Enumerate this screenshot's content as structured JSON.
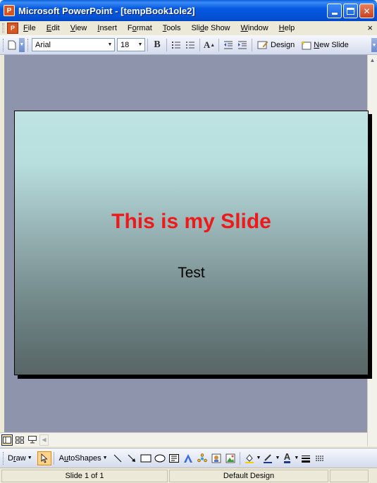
{
  "window": {
    "app_icon": "powerpoint-icon",
    "title": "Microsoft PowerPoint - [tempBook1ole2]",
    "controls": [
      "minimize-icon",
      "maximize-icon",
      "close-icon"
    ]
  },
  "menu": {
    "items": [
      {
        "pre": "",
        "acc": "F",
        "post": "ile"
      },
      {
        "pre": "",
        "acc": "E",
        "post": "dit"
      },
      {
        "pre": "",
        "acc": "V",
        "post": "iew"
      },
      {
        "pre": "",
        "acc": "I",
        "post": "nsert"
      },
      {
        "pre": "F",
        "acc": "o",
        "post": "rmat"
      },
      {
        "pre": "",
        "acc": "T",
        "post": "ools"
      },
      {
        "pre": "Sli",
        "acc": "d",
        "post": "e Show"
      },
      {
        "pre": "",
        "acc": "W",
        "post": "indow"
      },
      {
        "pre": "",
        "acc": "H",
        "post": "elp"
      }
    ],
    "close_glyph": "×"
  },
  "toolbar": {
    "font_name": "Arial",
    "font_size": "18",
    "bold_label": "B",
    "design_label": "Design",
    "new_slide_pre": "",
    "new_slide_acc": "N",
    "new_slide_post": "ew Slide",
    "icons": [
      "new-document-icon",
      "bold-icon",
      "numbering-icon",
      "bullets-icon",
      "increase-font-icon",
      "decrease-indent-icon",
      "increase-indent-icon",
      "design-icon",
      "new-slide-icon"
    ]
  },
  "slide": {
    "title": "This is my Slide",
    "subtitle": "Test",
    "title_color": "#ee1a1a",
    "gradient_top": "#bfe3e3",
    "gradient_bottom": "#576565"
  },
  "views": [
    "normal-view-icon",
    "slide-sorter-icon",
    "slide-show-icon"
  ],
  "drawing": {
    "draw_pre": "D",
    "draw_acc": "r",
    "draw_post": "aw",
    "autoshapes_pre": "A",
    "autoshapes_acc": "u",
    "autoshapes_post": "toShapes",
    "icons": [
      "select-arrow-icon",
      "line-icon",
      "arrow-icon",
      "rectangle-icon",
      "oval-icon",
      "text-box-icon",
      "wordart-icon",
      "diagram-icon",
      "clip-art-icon",
      "picture-icon",
      "fill-color-icon",
      "line-color-icon",
      "font-color-icon",
      "line-style-icon",
      "dash-style-icon"
    ]
  },
  "status": {
    "slide_position": "Slide 1 of 1",
    "design": "Default Design"
  }
}
